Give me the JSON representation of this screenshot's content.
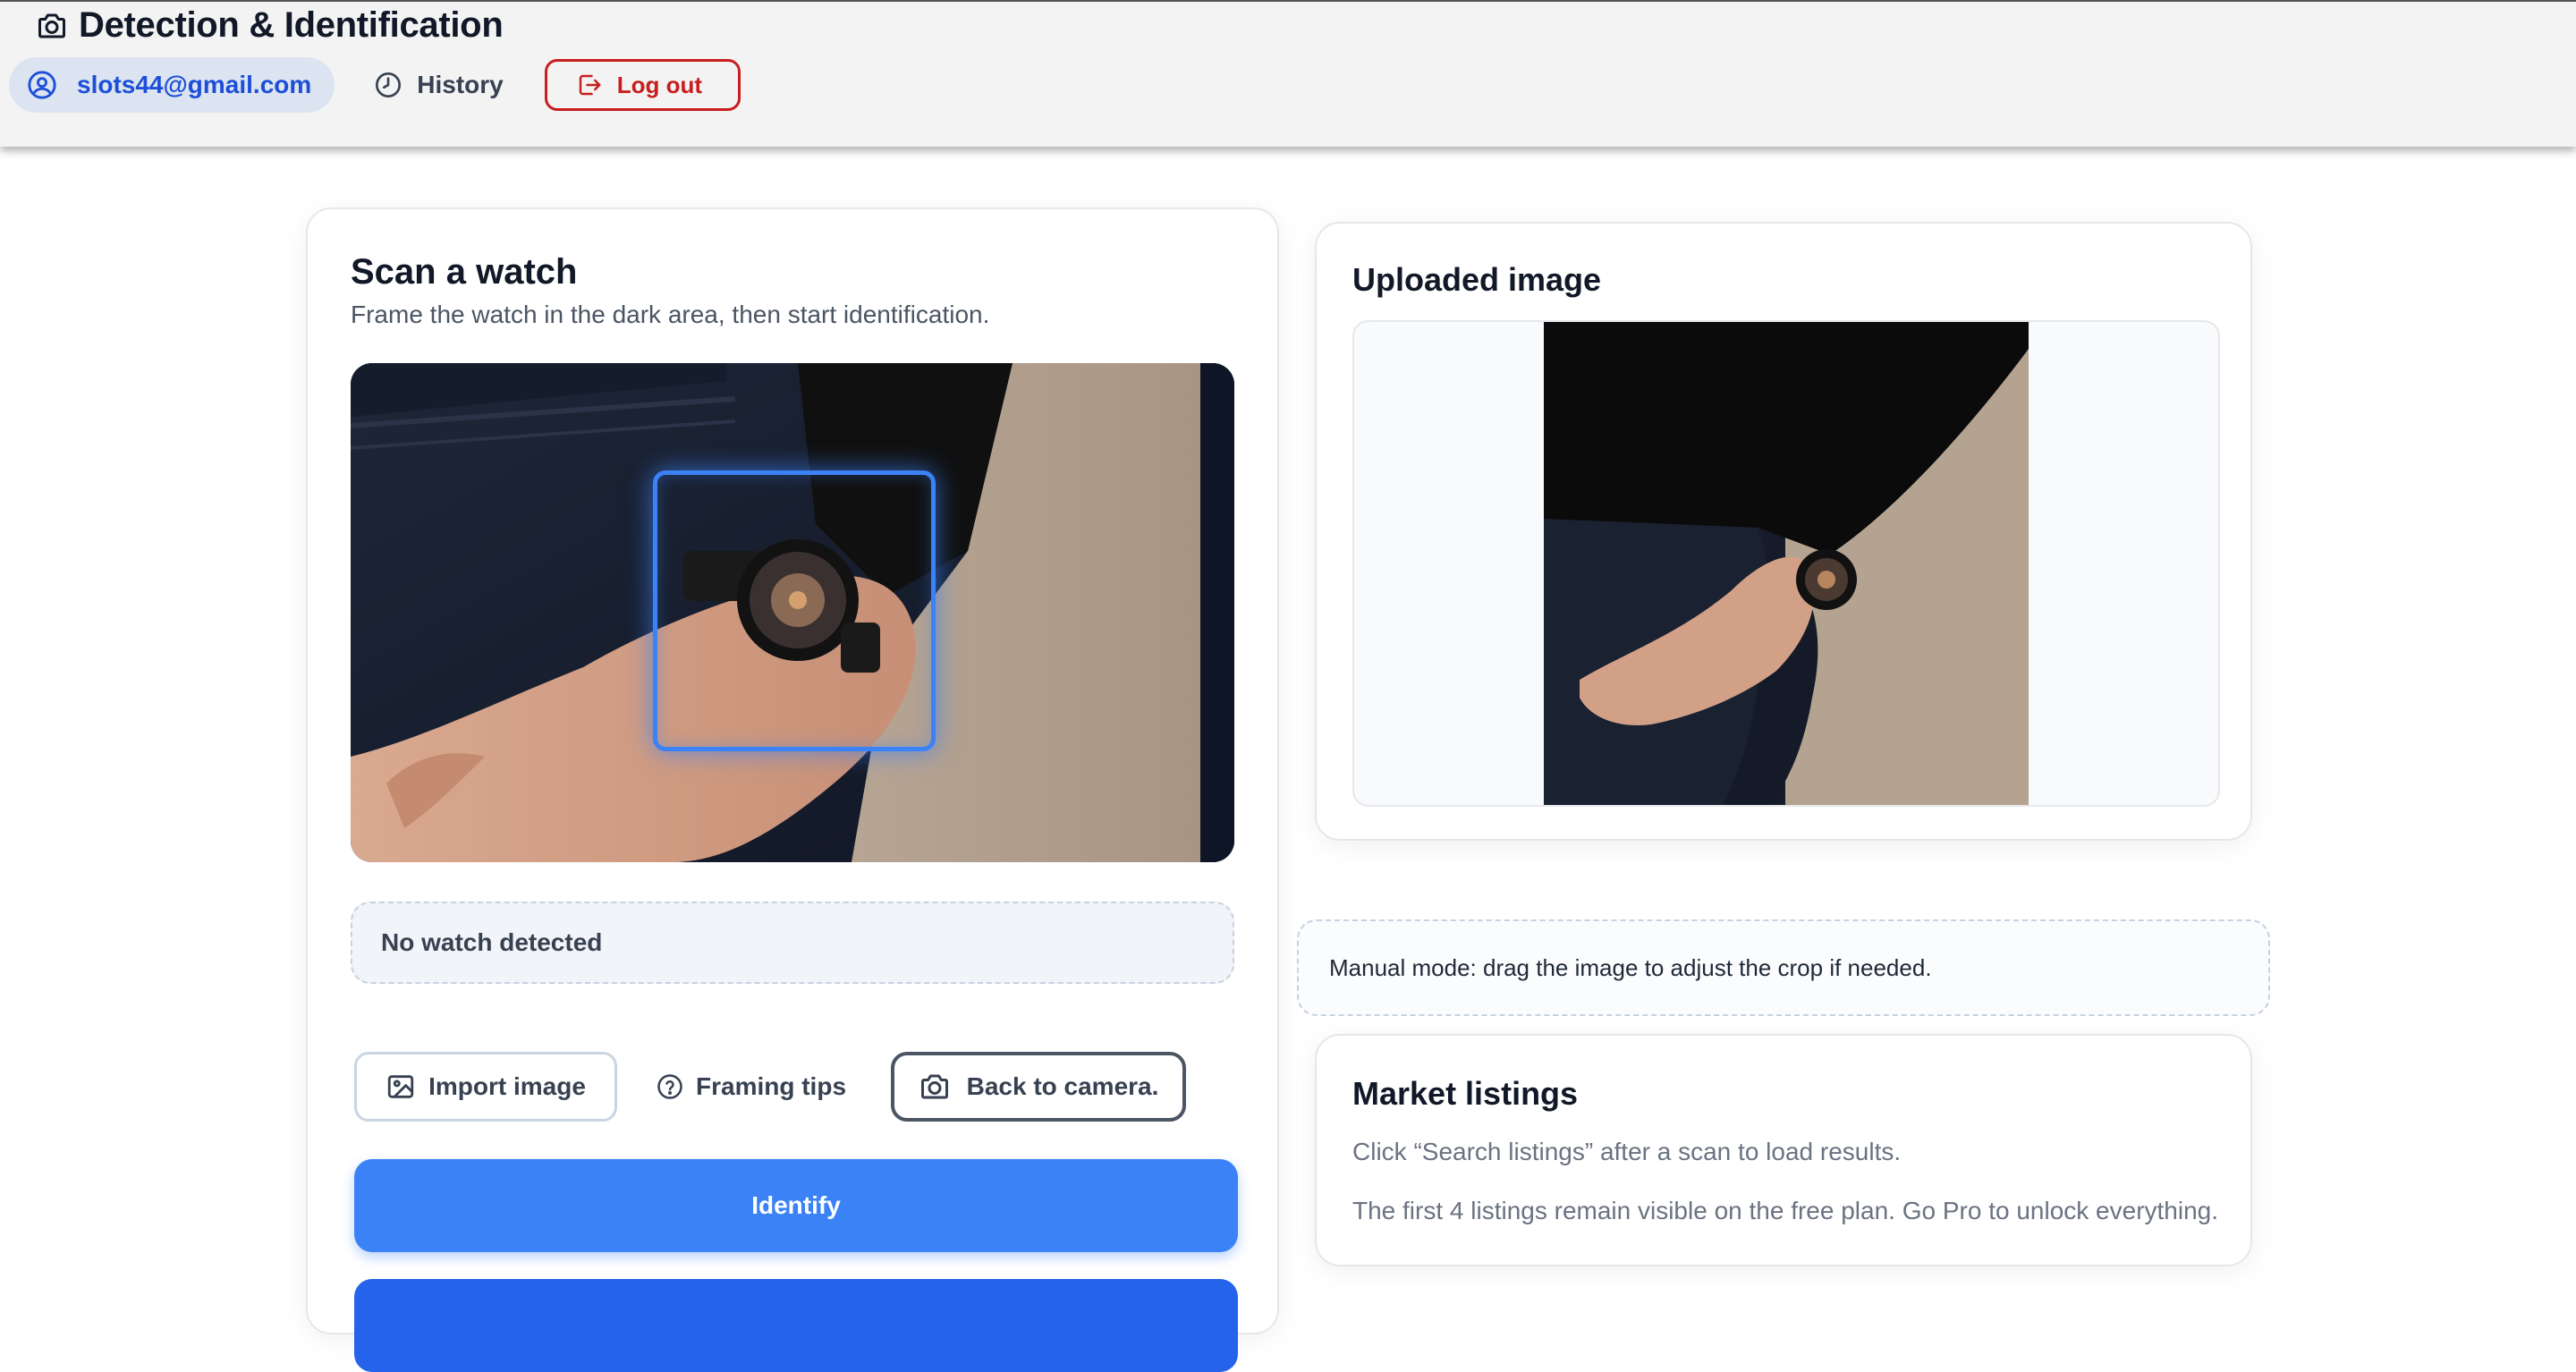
{
  "header": {
    "title": "Detection & Identification",
    "user_email": "slots44@gmail.com",
    "history_label": "History",
    "logout_label": "Log out"
  },
  "scan": {
    "title": "Scan a watch",
    "subtitle": "Frame the watch in the dark area, then start identification.",
    "status": "No watch detected",
    "import_label": "Import image",
    "tips_label": "Framing tips",
    "back_label": "Back to camera.",
    "identify_label": "Identify"
  },
  "upload": {
    "title": "Uploaded image"
  },
  "manual": {
    "text": "Manual mode: drag the image to adjust the crop if needed."
  },
  "market": {
    "title": "Market listings",
    "line1": "Click “Search listings” after a scan to load results.",
    "line2": "The first 4 listings remain visible on the free plan. Go Pro to unlock everything."
  },
  "colors": {
    "accent": "#3b82f6",
    "danger": "#c81e1e",
    "user_chip_bg": "#dbe4f0",
    "user_text": "#1d4ed8"
  },
  "icons": {
    "header": "camera-icon",
    "user": "user-circle-icon",
    "history": "clock-icon",
    "logout": "logout-icon",
    "import": "image-icon",
    "tips": "help-circle-icon",
    "back": "camera-icon"
  }
}
